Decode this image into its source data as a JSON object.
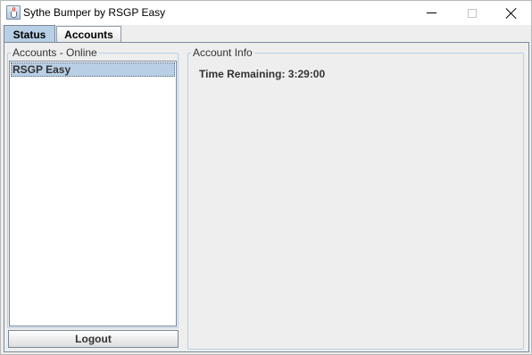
{
  "window": {
    "title": "Sythe Bumper by RSGP Easy",
    "icon": "java-cup-icon"
  },
  "tabs": [
    {
      "label": "Status",
      "selected": true
    },
    {
      "label": "Accounts",
      "selected": false
    }
  ],
  "accounts_online": {
    "title": "Accounts - Online",
    "items": [
      "RSGP Easy"
    ],
    "selected_index": 0,
    "logout_label": "Logout"
  },
  "account_info": {
    "title": "Account Info",
    "time_remaining_label": "Time Remaining: 3:29:00"
  },
  "colors": {
    "accent": "#b8cfe5",
    "border": "#7a8a99",
    "panel_bg": "#eeeeee"
  }
}
